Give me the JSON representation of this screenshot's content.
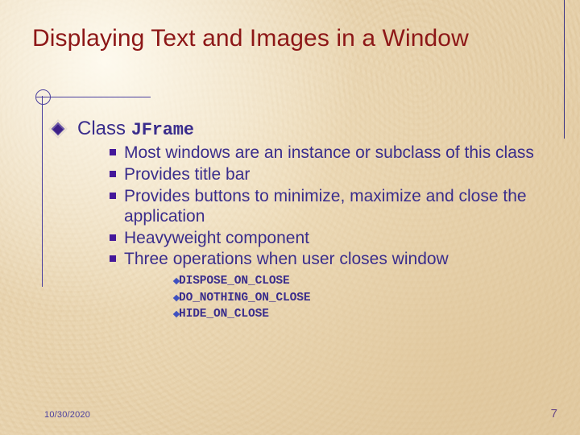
{
  "slide": {
    "title": "Displaying Text and Images in a Window",
    "title_color": "#8d1717",
    "body_color": "#3a2d8c",
    "accent_rule_color": "#4a3f9e",
    "background_color": "#eddcb8"
  },
  "content": {
    "level1": {
      "label_plain": "Class ",
      "label_code": "JFrame"
    },
    "level2_items": [
      "Most windows are an instance or subclass of this class",
      "Provides title bar",
      "Provides buttons to minimize, maximize and close the application",
      "Heavyweight component",
      "Three operations when user closes window"
    ],
    "level3_items": [
      "DISPOSE_ON_CLOSE",
      "DO_NOTHING_ON_CLOSE",
      "HIDE_ON_CLOSE"
    ]
  },
  "footer": {
    "date": "10/30/2020",
    "page_number": "7"
  }
}
